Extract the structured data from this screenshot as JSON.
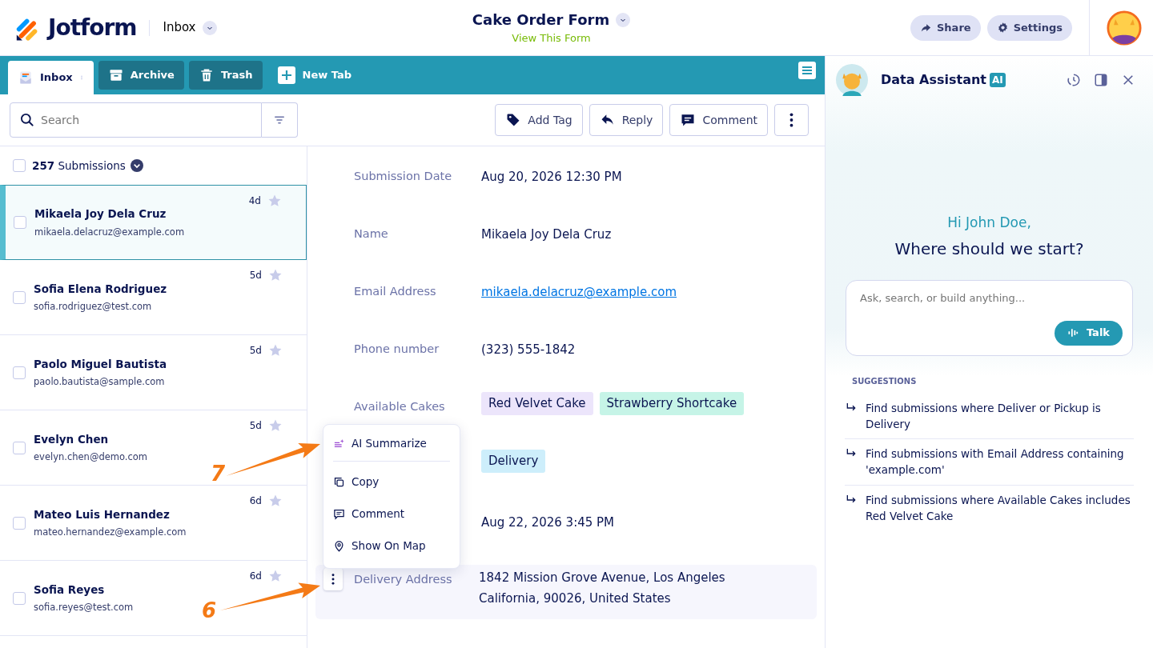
{
  "header": {
    "brand": "Jotform",
    "section": "Inbox",
    "form_title": "Cake Order Form",
    "form_link": "View This Form",
    "buttons": [
      {
        "label": "Share",
        "kind": "share"
      },
      {
        "label": "Settings",
        "kind": "settings"
      }
    ]
  },
  "tabs": [
    {
      "label": "Inbox",
      "kind": "inbox",
      "selected": true
    },
    {
      "label": "Archive",
      "kind": "archive",
      "selected": false
    },
    {
      "label": "Trash",
      "kind": "trash",
      "selected": false
    },
    {
      "label": "New Tab",
      "kind": "new",
      "selected": false
    }
  ],
  "search": {
    "placeholder": "Search"
  },
  "actions": [
    {
      "label": "Add Tag",
      "kind": "tag"
    },
    {
      "label": "Reply",
      "kind": "reply"
    },
    {
      "label": "Comment",
      "kind": "comment"
    },
    {
      "kind": "more"
    }
  ],
  "list_header": {
    "count": "**257** Submissions",
    "checked": false
  },
  "submissions": [
    {
      "name": "Mikaela Joy Dela Cruz",
      "email": "mikaela.delacruz@example.com",
      "age": "4d",
      "selected": true,
      "checked": false,
      "starred": false
    },
    {
      "name": "Sofia Elena Rodriguez",
      "email": "sofia.rodriguez@test.com",
      "age": "5d",
      "selected": false,
      "checked": false,
      "starred": false
    },
    {
      "name": "Paolo Miguel Bautista",
      "email": "paolo.bautista@sample.com",
      "age": "5d",
      "selected": false,
      "checked": false,
      "starred": false
    },
    {
      "name": "Evelyn Chen",
      "email": "evelyn.chen@demo.com",
      "age": "5d",
      "selected": false,
      "checked": false,
      "starred": false
    },
    {
      "name": "Mateo Luis Hernandez",
      "email": "mateo.hernandez@example.com",
      "age": "6d",
      "selected": false,
      "checked": false,
      "starred": false
    },
    {
      "name": "Sofia Reyes",
      "email": "sofia.reyes@test.com",
      "age": "6d",
      "selected": false,
      "checked": false,
      "starred": false
    }
  ],
  "fields": [
    {
      "kind": "text",
      "label": "Submission Date",
      "value": "Aug 20, 2026 12:30 PM",
      "highlighted": false
    },
    {
      "kind": "text",
      "label": "Name",
      "value": "Mikaela Joy Dela Cruz",
      "highlighted": false
    },
    {
      "kind": "link",
      "label": "Email Address",
      "value": "mikaela.delacruz@example.com",
      "highlighted": false
    },
    {
      "kind": "text",
      "label": "Phone number",
      "value": "(323) 555-1842",
      "highlighted": false
    },
    {
      "kind": "tags",
      "label": "Available Cakes",
      "tags": [
        {
          "text": "Red Velvet Cake",
          "color": "#ece5fb"
        },
        {
          "text": "Strawberry Shortcake",
          "color": "#c6f4e7"
        }
      ],
      "highlighted": false
    },
    {
      "kind": "tags",
      "tags": [
        {
          "text": "Delivery",
          "color": "#cdeefb"
        }
      ],
      "highlighted": false
    },
    {
      "kind": "text",
      "value": "Aug 22, 2026 3:45 PM",
      "highlighted": false
    },
    {
      "kind": "address",
      "label": "Delivery Address",
      "lines": [
        "1842 Mission Grove Avenue, Los Angeles",
        "California, 90026, United States"
      ],
      "highlighted": true
    }
  ],
  "context_menu": {
    "items": [
      {
        "label": "AI Summarize",
        "kind": "ai"
      },
      {
        "label": "Copy",
        "kind": "copy"
      },
      {
        "label": "Comment",
        "kind": "comment"
      },
      {
        "label": "Show On Map",
        "kind": "map"
      }
    ]
  },
  "annotations": [
    {
      "label": "7"
    },
    {
      "label": "6"
    }
  ],
  "assistant": {
    "title": "Data Assistant",
    "badge": "AI",
    "greeting": "Hi John Doe,",
    "question": "Where should we start?",
    "prompt": {
      "placeholder": "Ask, search, or build anything..."
    },
    "talk_button": "Talk",
    "suggestions_heading": "SUGGESTIONS",
    "suggestions": [
      "Find submissions where Deliver or Pickup is Delivery",
      "Find submissions with Email Address containing 'example.com'",
      "Find submissions where Available Cakes includes Red Velvet Cake"
    ]
  }
}
